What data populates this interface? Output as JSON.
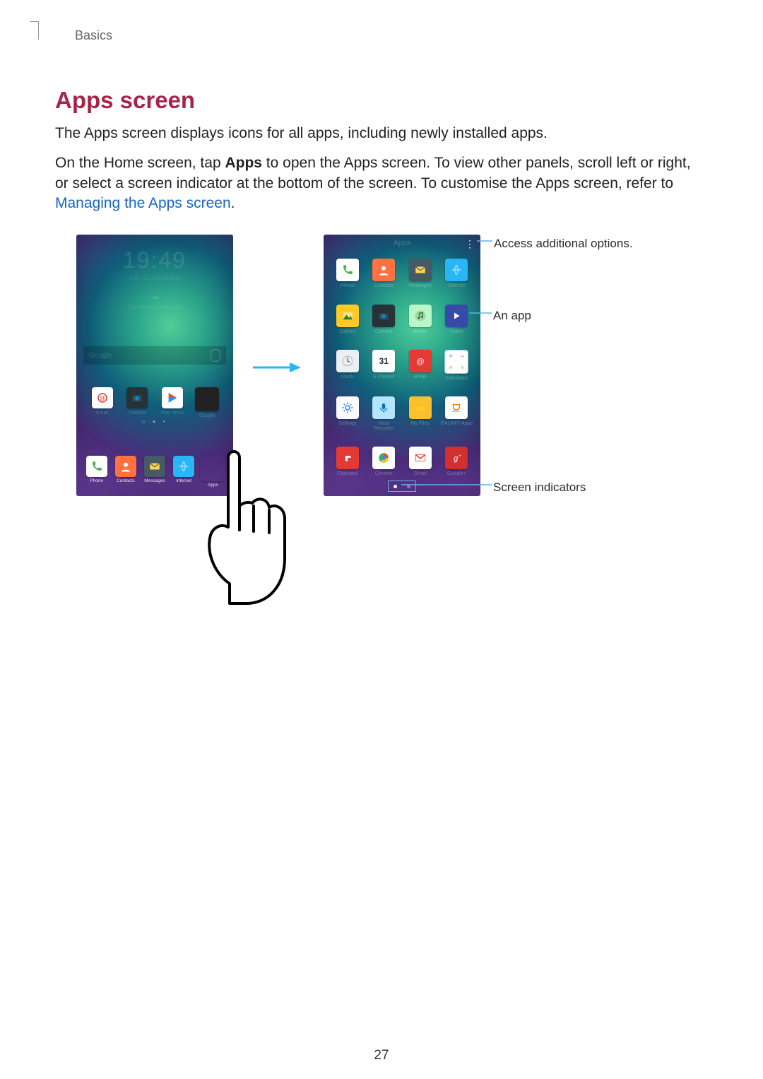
{
  "breadcrumb": "Basics",
  "heading": "Apps screen",
  "paragraph1": "The Apps screen displays icons for all apps, including newly installed apps.",
  "paragraph2_a": "On the Home screen, tap ",
  "paragraph2_bold": "Apps",
  "paragraph2_b": " to open the Apps screen. To view other panels, scroll left or right, or select a screen indicator at the bottom of the screen. To customise the Apps screen, refer to ",
  "paragraph2_link": "Managing the Apps screen",
  "paragraph2_end": ".",
  "page_number": "27",
  "callouts": {
    "additional_options": "Access additional options.",
    "an_app": "An app",
    "screen_indicators": "Screen indicators"
  },
  "home_screen": {
    "time": "19:49",
    "date_faint": "Sun, 21 December",
    "weather_icon_alt": "weather",
    "weather_sub": "Tap here to add a city",
    "search_placeholder": "Google",
    "row1": [
      {
        "name": "email",
        "label": "Email"
      },
      {
        "name": "camera",
        "label": "Camera"
      },
      {
        "name": "play",
        "label": "Play Store"
      },
      {
        "name": "google",
        "label": "Google"
      }
    ],
    "dock": [
      {
        "name": "phone",
        "label": "Phone"
      },
      {
        "name": "contacts",
        "label": "Contacts"
      },
      {
        "name": "messages",
        "label": "Messages"
      },
      {
        "name": "internet",
        "label": "Internet"
      },
      {
        "name": "apps",
        "label": "Apps"
      }
    ]
  },
  "apps_screen": {
    "title": "Apps",
    "calendar_day": "31",
    "rows": [
      [
        {
          "name": "phone",
          "label": "Phone"
        },
        {
          "name": "contacts",
          "label": "Contacts"
        },
        {
          "name": "messages",
          "label": "Messages"
        },
        {
          "name": "internet",
          "label": "Internet"
        }
      ],
      [
        {
          "name": "gallery",
          "label": "Gallery"
        },
        {
          "name": "camera",
          "label": "Camera"
        },
        {
          "name": "music",
          "label": "Music"
        },
        {
          "name": "video",
          "label": "Video"
        }
      ],
      [
        {
          "name": "clock",
          "label": "Clock"
        },
        {
          "name": "calendar",
          "label": "S Planner"
        },
        {
          "name": "email",
          "label": "Email"
        },
        {
          "name": "calculator",
          "label": "Calculator"
        }
      ],
      [
        {
          "name": "settings",
          "label": "Settings"
        },
        {
          "name": "voice",
          "label": "Voice Recorder"
        },
        {
          "name": "files",
          "label": "My Files"
        },
        {
          "name": "galaxy",
          "label": "GALAXY Apps"
        }
      ],
      [
        {
          "name": "flipboard",
          "label": "Flipboard"
        },
        {
          "name": "chrome",
          "label": "Chrome"
        },
        {
          "name": "gmail",
          "label": "Gmail"
        },
        {
          "name": "googleplus",
          "label": "Google+"
        }
      ]
    ]
  }
}
